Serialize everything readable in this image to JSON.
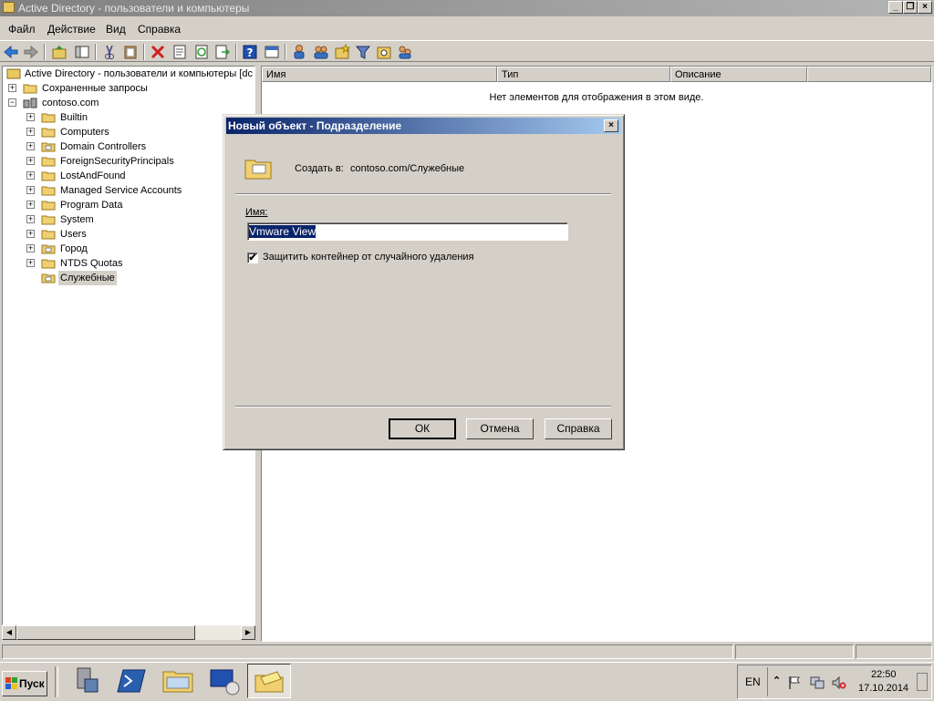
{
  "window": {
    "title": "Active Directory - пользователи и компьютеры"
  },
  "menu": [
    "Файл",
    "Действие",
    "Вид",
    "Справка"
  ],
  "tree": {
    "root_label": "Active Directory - пользователи и компьютеры [dc",
    "saved_queries": "Сохраненные запросы",
    "domain": "contoso.com",
    "children": [
      "Builtin",
      "Computers",
      "Domain Controllers",
      "ForeignSecurityPrincipals",
      "LostAndFound",
      "Managed Service Accounts",
      "Program Data",
      "System",
      "Users",
      "Город",
      "NTDS Quotas",
      "Служебные"
    ]
  },
  "list": {
    "columns": [
      "Имя",
      "Тип",
      "Описание"
    ],
    "empty_message": "Нет элементов для отображения в этом виде."
  },
  "dialog": {
    "title": "Новый объект - Подразделение",
    "close_symbol": "×",
    "create_in_label": "Создать в:",
    "create_in_value": "contoso.com/Служебные",
    "name_label": "Имя:",
    "name_value": "Vmware View",
    "protect_label": "Защитить контейнер от случайного удаления",
    "protect_checked": "✔",
    "ok": "ОК",
    "cancel": "Отмена",
    "help": "Справка"
  },
  "taskbar": {
    "start": "Пуск",
    "lang": "EN",
    "time": "22:50",
    "date": "17.10.2014"
  },
  "window_controls": {
    "minimize": "_",
    "restore": "❐",
    "close": "×"
  }
}
